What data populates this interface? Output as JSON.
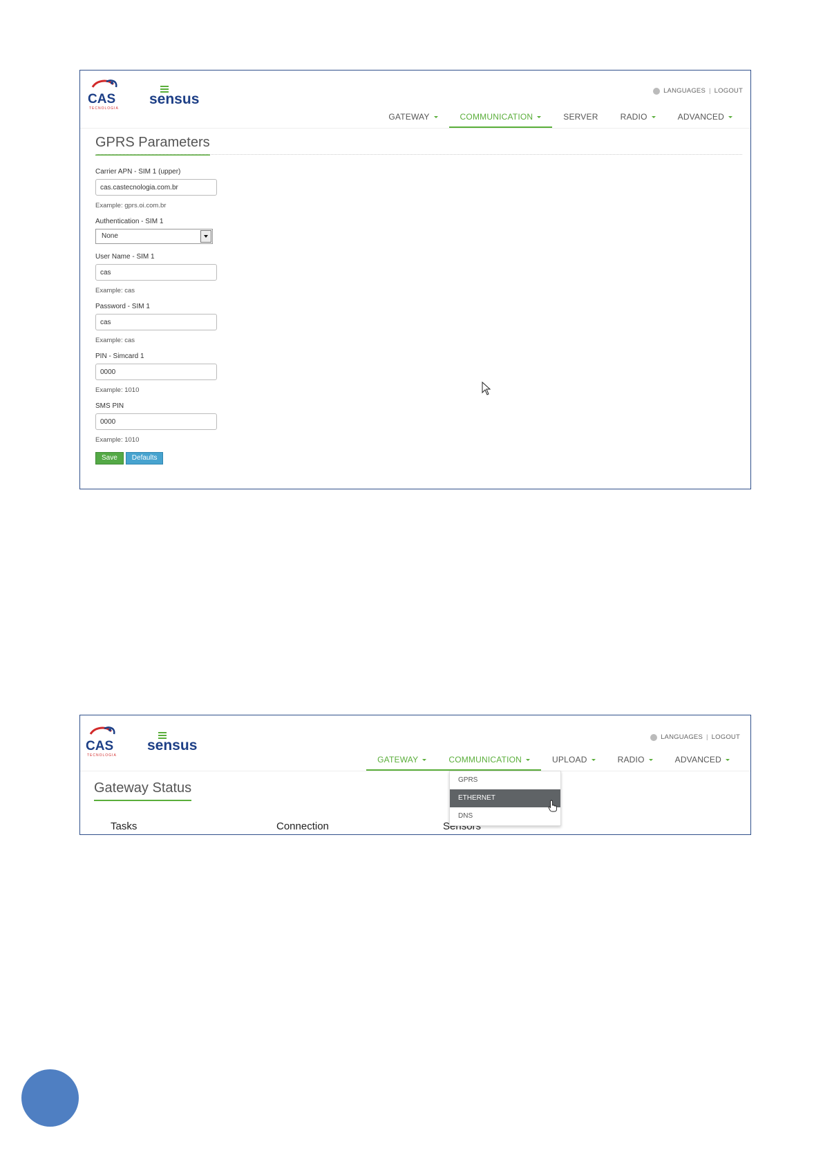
{
  "screen1": {
    "brand": {
      "cas": "CAS",
      "cas_sub": "TECNOLOGIA",
      "sensus": "sensus"
    },
    "top_links": {
      "languages": "LANGUAGES",
      "separator": "|",
      "logout": "LOGOUT"
    },
    "nav": [
      {
        "label": "GATEWAY",
        "dropdown": true,
        "active": false
      },
      {
        "label": "COMMUNICATION",
        "dropdown": true,
        "active": true
      },
      {
        "label": "SERVER",
        "dropdown": false,
        "active": false
      },
      {
        "label": "RADIO",
        "dropdown": true,
        "active": false
      },
      {
        "label": "ADVANCED",
        "dropdown": true,
        "active": false
      }
    ],
    "page_title": "GPRS Parameters",
    "form": {
      "apn_label": "Carrier APN - SIM 1 (upper)",
      "apn_value": "cas.castecnologia.com.br",
      "apn_help": "Example: gprs.oi.com.br",
      "auth_label": "Authentication - SIM 1",
      "auth_value": "None",
      "user_label": "User Name - SIM 1",
      "user_value": "cas",
      "user_help": "Example: cas",
      "pass_label": "Password - SIM 1",
      "pass_value": "cas",
      "pass_help": "Example: cas",
      "pin_label": "PIN - Simcard 1",
      "pin_value": "0000",
      "pin_help": "Example: 1010",
      "sms_label": "SMS PIN",
      "sms_value": "0000",
      "sms_help": "Example: 1010",
      "save_label": "Save",
      "defaults_label": "Defaults"
    }
  },
  "screen2": {
    "brand": {
      "cas": "CAS",
      "cas_sub": "TECNOLOGIA",
      "sensus": "sensus"
    },
    "top_links": {
      "languages": "LANGUAGES",
      "separator": "|",
      "logout": "LOGOUT"
    },
    "nav": [
      {
        "label": "GATEWAY",
        "dropdown": true,
        "active": true
      },
      {
        "label": "COMMUNICATION",
        "dropdown": true,
        "active": true
      },
      {
        "label": "UPLOAD",
        "dropdown": true,
        "active": false
      },
      {
        "label": "RADIO",
        "dropdown": true,
        "active": false
      },
      {
        "label": "ADVANCED",
        "dropdown": true,
        "active": false
      }
    ],
    "page_title": "Gateway Status",
    "columns": [
      "Tasks",
      "Connection",
      "Sensors"
    ],
    "dropdown_items": [
      {
        "label": "GPRS",
        "highlighted": false
      },
      {
        "label": "ETHERNET",
        "highlighted": true
      },
      {
        "label": "DNS",
        "highlighted": false
      }
    ]
  },
  "colors": {
    "accent_green": "#5aae3a",
    "save_green": "#54a946",
    "defaults_blue": "#47a3cf",
    "frame_border": "#2f4f8a",
    "page_circle": "#4f7fc2",
    "dropdown_highlight": "#5f6366"
  },
  "icons": [
    "cas-logo",
    "sensus-logo",
    "globe-icon",
    "chevron-down-icon",
    "mouse-pointer-icon",
    "hand-pointer-icon"
  ]
}
